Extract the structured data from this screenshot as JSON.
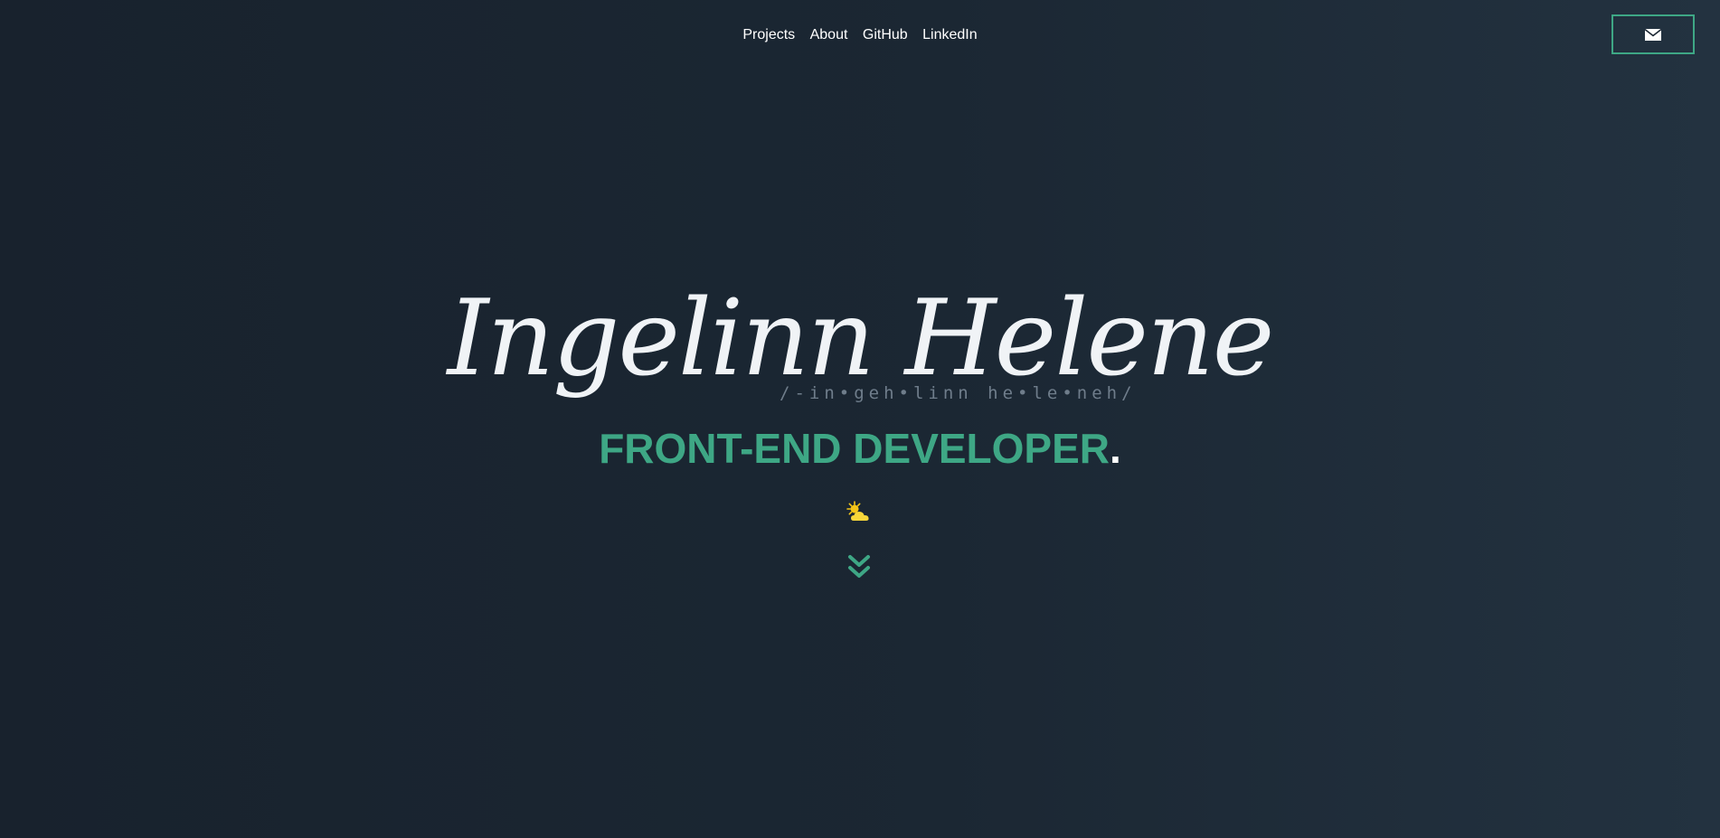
{
  "nav": {
    "items": [
      "Projects",
      "About",
      "GitHub",
      "LinkedIn"
    ]
  },
  "contact": {
    "icon": "envelope-icon"
  },
  "hero": {
    "name": "Ingelinn Helene",
    "pronunciation": "/-in•geh•linn he•le•neh/",
    "role": "FRONT-END DEVELOPER",
    "role_suffix": ".",
    "weather_icon": "partly-sunny-icon",
    "scroll_icon": "double-chevron-down-icon"
  },
  "colors": {
    "accent": "#3ea785",
    "background": "#1b2733",
    "muted": "#6f7d8b",
    "sun": "#f5c518"
  }
}
